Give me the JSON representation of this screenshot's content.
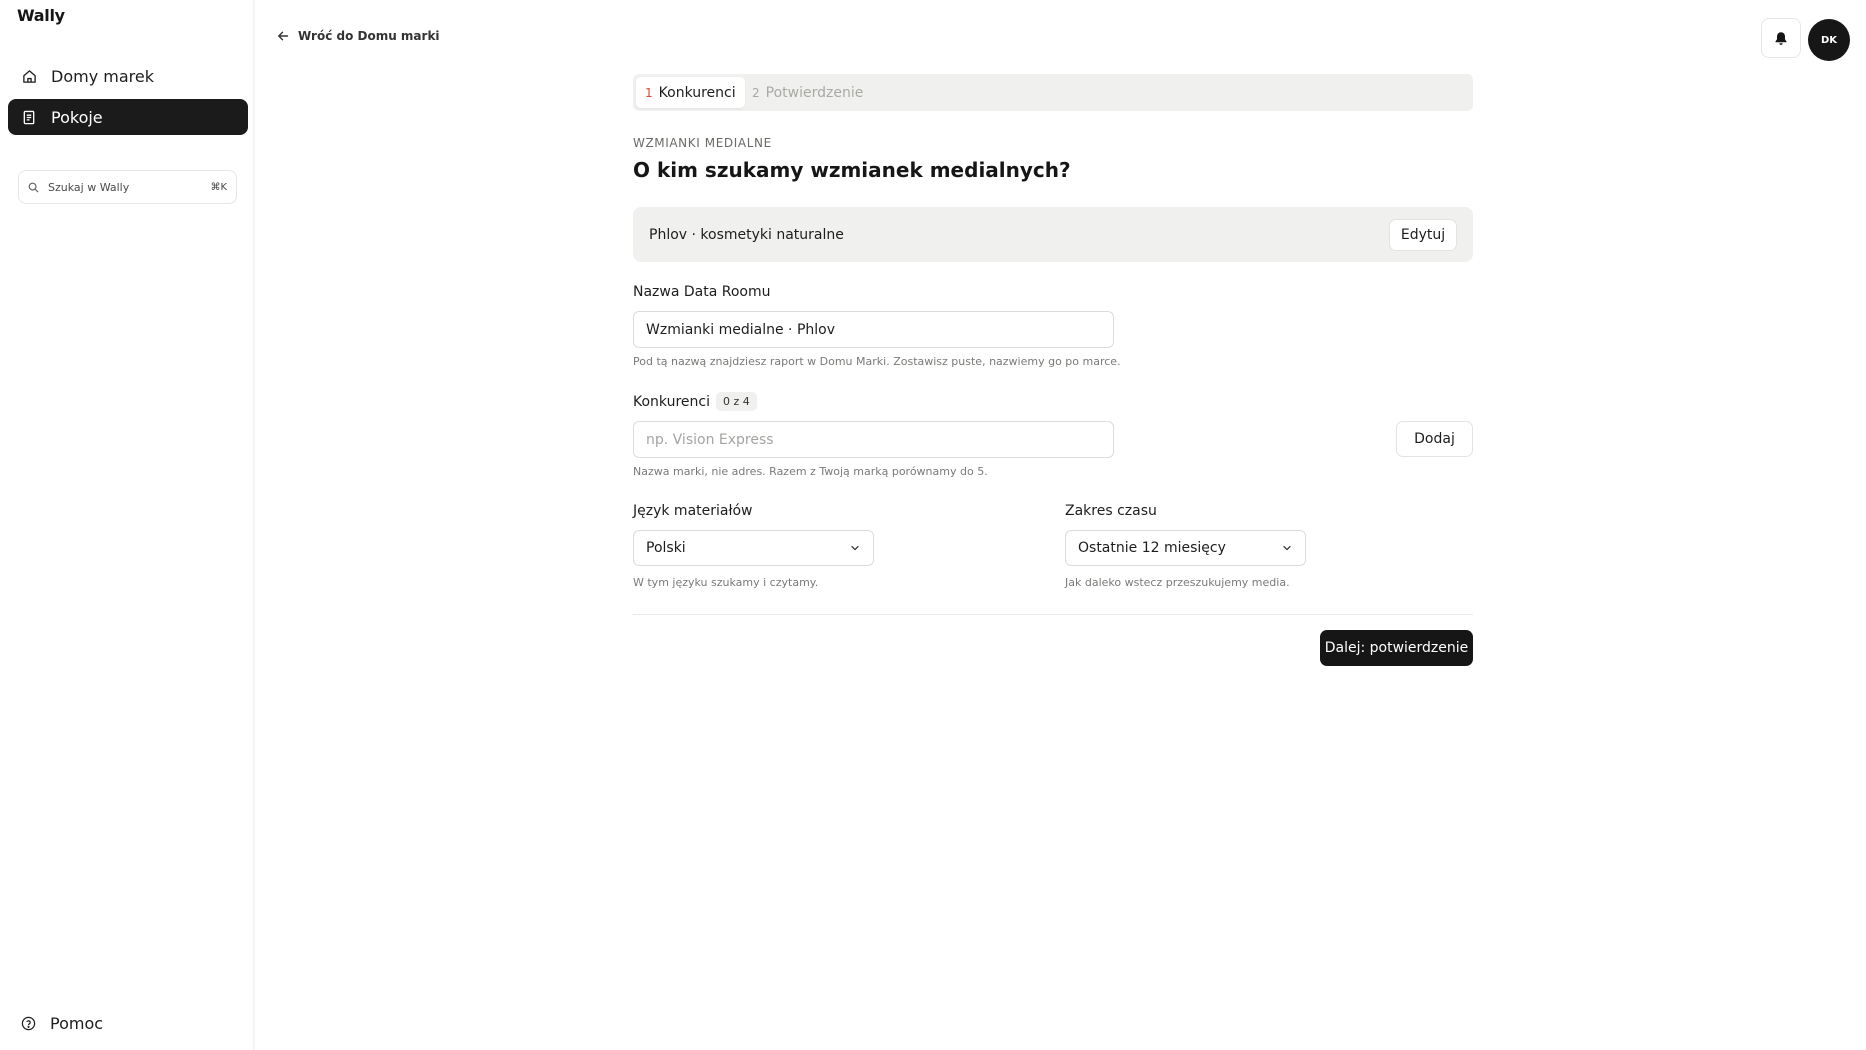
{
  "app": {
    "name": "Wally"
  },
  "sidebar": {
    "items": [
      {
        "label": "Domy marek",
        "icon": "home-icon",
        "active": false
      },
      {
        "label": "Pokoje",
        "icon": "document-icon",
        "active": true
      }
    ],
    "search": {
      "placeholder": "Szukaj w Wally",
      "shortcut": "⌘K"
    },
    "help": {
      "label": "Pomoc",
      "icon": "help-circle-icon"
    }
  },
  "header": {
    "back_label": "Wróć do Domu marki",
    "avatar_initials": "DK",
    "bell_icon": "bell-icon"
  },
  "steps": [
    {
      "num": "1",
      "label": "Konkurenci",
      "active": true
    },
    {
      "num": "2",
      "label": "Potwierdzenie",
      "active": false
    }
  ],
  "form": {
    "eyebrow": "WZMIANKI MEDIALNE",
    "title": "O kim szukamy wzmianek medialnych?",
    "brand_summary": "Phlov · kosmetyki naturalne",
    "edit_label": "Edytuj",
    "room_name": {
      "label": "Nazwa Data Roomu",
      "value": "Wzmianki medialne · Phlov",
      "hint": "Pod tą nazwą znajdziesz raport w Domu Marki. Zostawisz puste, nazwiemy go po marce."
    },
    "competitors": {
      "label": "Konkurenci",
      "count_badge": "0 z 4",
      "placeholder": "np. Vision Express",
      "add_label": "Dodaj",
      "hint": "Nazwa marki, nie adres. Razem z Twoją marką porównamy do 5."
    },
    "language": {
      "label": "Język materiałów",
      "value": "Polski",
      "hint": "W tym języku szukamy i czytamy."
    },
    "time_range": {
      "label": "Zakres czasu",
      "value": "Ostatnie 12 miesięcy",
      "hint": "Jak daleko wstecz przeszukujemy media."
    },
    "next_label": "Dalej: potwierdzenie"
  },
  "colors": {
    "accent_dark": "#161616",
    "step_number_active": "#e0473a",
    "panel_bg": "#f0f0ee"
  }
}
